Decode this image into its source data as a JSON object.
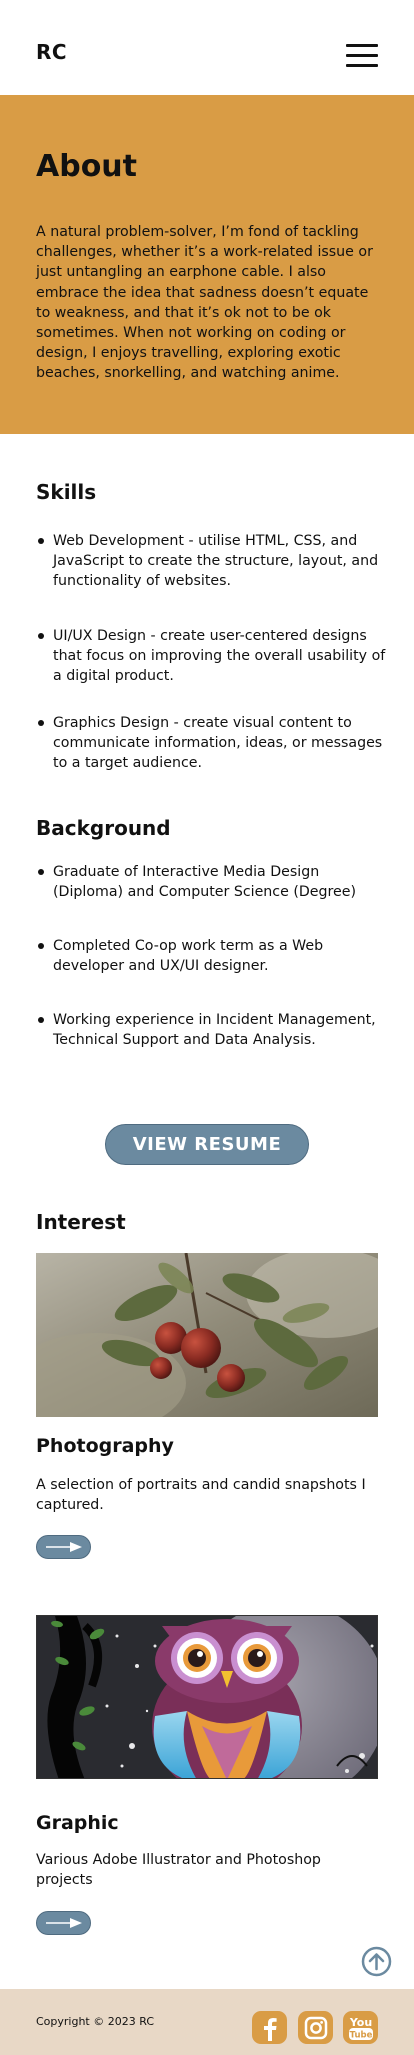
{
  "header": {
    "logo": "RC",
    "menu_icon": "hamburger-menu-icon"
  },
  "about": {
    "title": "About",
    "text": "A natural problem-solver, I’m fond of tackling challenges, whether it’s a work-related issue or just untangling an earphone cable. I also embrace the idea that sadness doesn’t equate to weakness, and that it’s ok not to be ok sometimes. When not working on coding or design, I enjoys travelling, exploring exotic beaches, snorkelling, and watching anime."
  },
  "skills": {
    "title": "Skills",
    "items": [
      "Web Development - utilise  HTML, CSS, and JavaScript to create the structure, layout, and functionality of websites.",
      "UI/UX Design - create user-centered designs that focus on improving the overall usability of a digital product.",
      "Graphics Design -  create visual content to communicate information, ideas, or messages to a target audience."
    ]
  },
  "background": {
    "title": "Background",
    "items": [
      "Graduate of Interactive Media Design (Diploma) and Computer Science (Degree)",
      "Completed Co-op work term as a Web developer and UX/UI designer.",
      "Working experience in Incident Management, Technical Support and Data Analysis."
    ]
  },
  "resume_button": "VIEW RESUME",
  "interest": {
    "title": "Interest",
    "cards": [
      {
        "title": "Photography",
        "description": "A selection of portraits and candid snapshots I captured.",
        "image": "berries-photo",
        "button_icon": "arrow-right-icon"
      },
      {
        "title": "Graphic",
        "description": "Various Adobe Illustrator and Photoshop projects",
        "image": "owl-illustration",
        "button_icon": "arrow-right-icon"
      }
    ]
  },
  "footer": {
    "copyright": "Copyright © 2023 RC",
    "social": [
      {
        "name": "facebook",
        "icon": "facebook-icon"
      },
      {
        "name": "instagram",
        "icon": "instagram-icon"
      },
      {
        "name": "youtube",
        "icon": "youtube-icon",
        "top_label": "You",
        "bottom_label": "Tube"
      }
    ]
  },
  "colors": {
    "accent": "#d99c45",
    "button": "#6b8aa0",
    "footer": "#e8d8c6"
  }
}
